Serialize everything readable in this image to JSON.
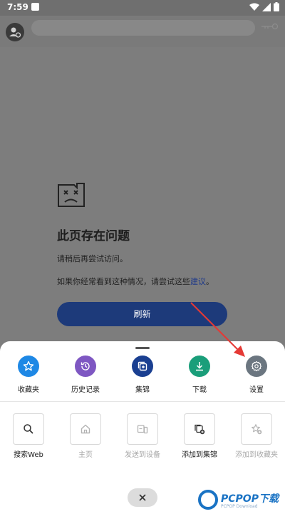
{
  "status": {
    "time": "7:59"
  },
  "error": {
    "title": "此页存在问题",
    "line1": "请稍后再尝试访问。",
    "line2_prefix": "如果你经常看到这种情况，请尝试这些",
    "line2_link": "建议",
    "line2_suffix": "。",
    "refresh_label": "刷新"
  },
  "sheet": {
    "top_items": [
      {
        "label": "收藏夹",
        "icon": "star-icon",
        "color": "#1e88e5"
      },
      {
        "label": "历史记录",
        "icon": "history-icon",
        "color": "#7e57c2"
      },
      {
        "label": "集锦",
        "icon": "collections-icon",
        "color": "#1a3f91"
      },
      {
        "label": "下载",
        "icon": "download-icon",
        "color": "#1a9e7a"
      },
      {
        "label": "设置",
        "icon": "gear-icon",
        "color": "#6b7680"
      }
    ],
    "box_items": [
      {
        "label": "搜索Web",
        "icon": "search-icon",
        "enabled": true
      },
      {
        "label": "主页",
        "icon": "home-icon",
        "enabled": false
      },
      {
        "label": "发送到设备",
        "icon": "send-to-device-icon",
        "enabled": false
      },
      {
        "label": "添加到集锦",
        "icon": "add-to-collection-icon",
        "enabled": true
      },
      {
        "label": "添加到收藏夹",
        "icon": "add-to-favorites-icon",
        "enabled": false
      }
    ],
    "close_icon": "close-icon"
  },
  "watermark": {
    "text": "PCPOP下载",
    "sub": "PCPOP Download"
  }
}
